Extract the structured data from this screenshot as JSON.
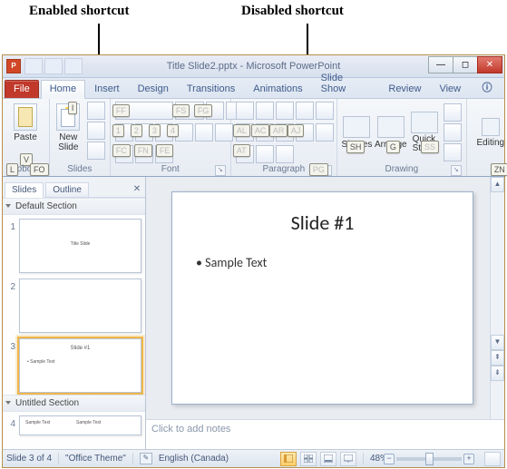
{
  "annotations": {
    "enabled": "Enabled shortcut",
    "disabled": "Disabled shortcut"
  },
  "window": {
    "title": "Title Slide2.pptx - Microsoft PowerPoint",
    "app_letter": "P",
    "sys_buttons": {
      "min": "—",
      "max": "◻",
      "close": "✕"
    }
  },
  "tabs": {
    "file": "File",
    "home": "Home",
    "insert": "Insert",
    "design": "Design",
    "transitions": "Transitions",
    "animations": "Animations",
    "slideshow": "Slide Show",
    "review": "Review",
    "view": "View",
    "help": "ⓘ"
  },
  "ribbon": {
    "clipboard": {
      "paste": "Paste",
      "label": "Clipboard"
    },
    "slides": {
      "new_slide": "New\nSlide",
      "label": "Slides"
    },
    "font": {
      "label": "Font"
    },
    "paragraph": {
      "label": "Paragraph"
    },
    "drawing": {
      "shapes": "Shapes",
      "arrange": "Arrange",
      "quick": "Quick\nStyles",
      "label": "Drawing"
    },
    "editing": {
      "label": "Editing",
      "btn": "Editing"
    }
  },
  "keytips": {
    "paste": "V",
    "clipboard": "FO",
    "newslide_top": "I",
    "slides_l": "L",
    "font_ff": "FF",
    "font_fs": "FS",
    "font_1": "1",
    "font_2": "2",
    "font_3": "3",
    "font_4": "4",
    "font_fc": "FC",
    "font_fn": "FN",
    "font_fg": "FG",
    "font_fe": "FE",
    "para_al": "AL",
    "para_ac": "AC",
    "para_ar": "AR",
    "para_aj": "AJ",
    "para_at": "AT",
    "para_pg": "PG",
    "shapes": "SH",
    "arrange": "G",
    "quick": "SS",
    "editing": "ZN"
  },
  "panel": {
    "slides_tab": "Slides",
    "outline_tab": "Outline",
    "close": "✕",
    "section_default": "Default Section",
    "section_untitled": "Untitled Section",
    "thumb1_title": "Title Slide",
    "thumb3_title": "Slide #1",
    "thumb3_line": "• Sample Text",
    "thumb4_l1": "Sample Text",
    "thumb4_l2": "Sample Text",
    "n1": "1",
    "n2": "2",
    "n3": "3",
    "n4": "4"
  },
  "slide": {
    "title": "Slide #1",
    "bullet": "• Sample Text"
  },
  "notes": {
    "placeholder": "Click to add notes"
  },
  "status": {
    "pos": "Slide 3 of 4",
    "theme": "\"Office Theme\"",
    "lang": "English (Canada)",
    "zoom": "48%",
    "spell_icon": "✎",
    "lang_icon": "🌐"
  }
}
